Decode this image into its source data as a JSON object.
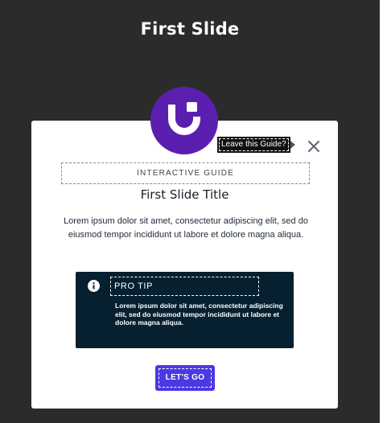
{
  "slide": {
    "title": "First Slide"
  },
  "guide": {
    "leave_tooltip": "Leave this Guide?",
    "label": "INTERACTIVE GUIDE",
    "title": "First Slide Title",
    "body": "Lorem ipsum dolor sit amet, consectetur adipiscing elit, sed do eiusmod tempor incididunt ut labore et dolore magna aliqua.",
    "tip": {
      "heading": "PRO TIP",
      "text": "Lorem ipsum dolor sit amet, consectetur adipiscing elit, sed do eiusmod tempor incididunt ut labore et dolore magna aliqua."
    },
    "cta_label": "LET'S GO"
  },
  "icons": {
    "logo": "smiley-logo-icon",
    "close": "close-icon",
    "info": "info-icon"
  },
  "colors": {
    "stage_background": "#2b2b2b",
    "logo": "#5b1fb0",
    "tip_background": "#06202f",
    "cta": "#4b39e3"
  }
}
